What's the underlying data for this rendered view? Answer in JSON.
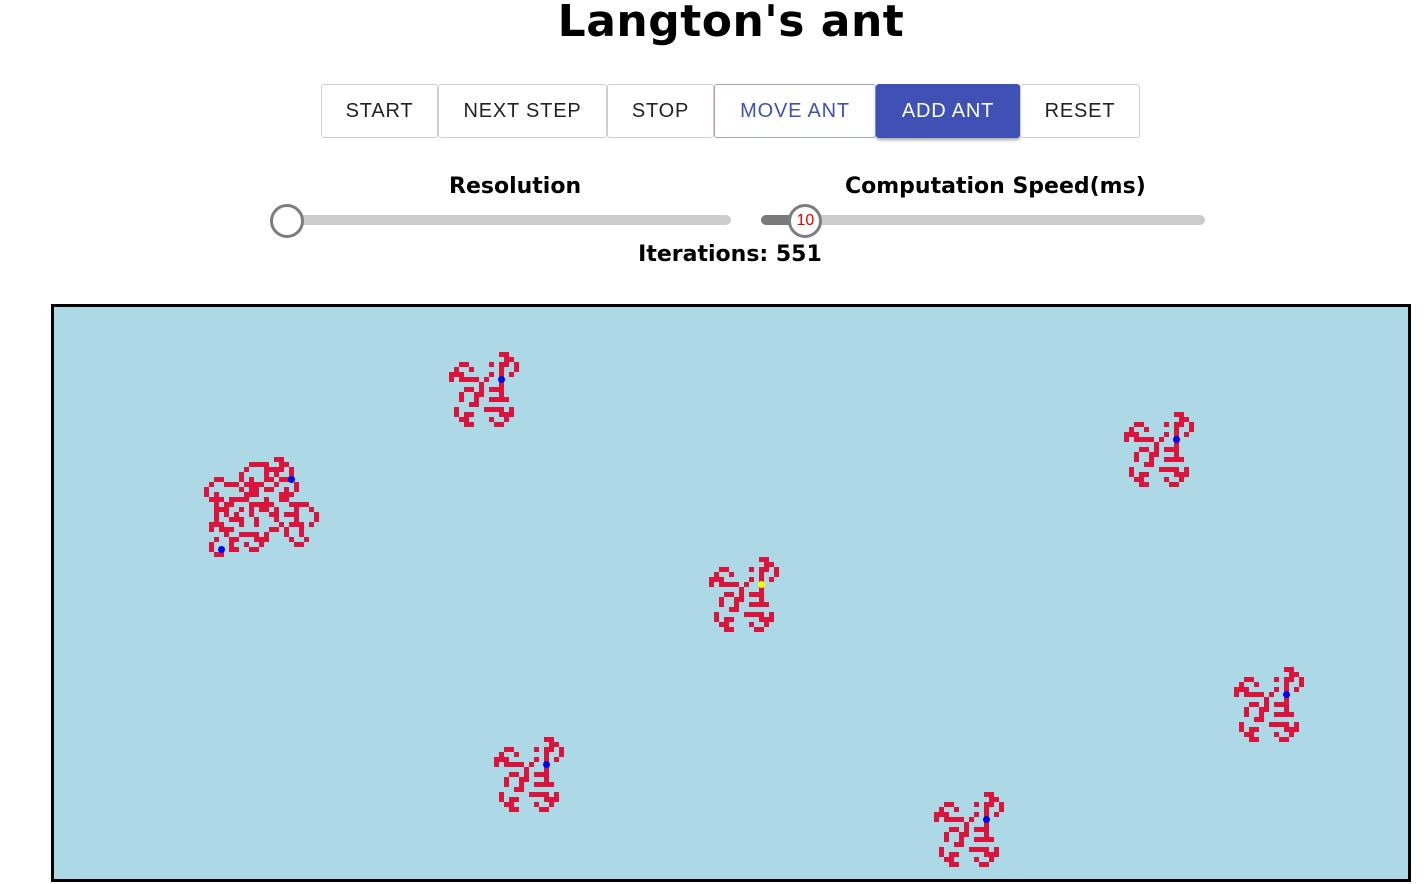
{
  "title": "Langton's ant",
  "toolbar": {
    "start_label": "START",
    "next_step_label": "NEXT STEP",
    "stop_label": "STOP",
    "move_ant_label": "MOVE ANT",
    "add_ant_label": "ADD ANT",
    "reset_label": "RESET"
  },
  "controls": {
    "resolution": {
      "label": "Resolution",
      "value_fraction": 0.0
    },
    "speed": {
      "label": "Computation Speed(ms)",
      "value": "10",
      "value_fraction": 0.1
    }
  },
  "status": {
    "iterations": "Iterations: 551"
  },
  "colors": {
    "board_background": "#add8e6",
    "trail": "#dc143c",
    "ant": "#0000ff",
    "selected_ant": "#ffff00",
    "primary": "#3f51b5"
  },
  "board": {
    "ants": [
      {
        "id": 1,
        "selected": false
      },
      {
        "id": 2,
        "selected": false
      },
      {
        "id": 3,
        "selected": false
      },
      {
        "id": 4,
        "selected": false
      },
      {
        "id": 5,
        "selected": true
      },
      {
        "id": 6,
        "selected": false
      },
      {
        "id": 7,
        "selected": false
      },
      {
        "id": 8,
        "selected": false
      }
    ]
  }
}
